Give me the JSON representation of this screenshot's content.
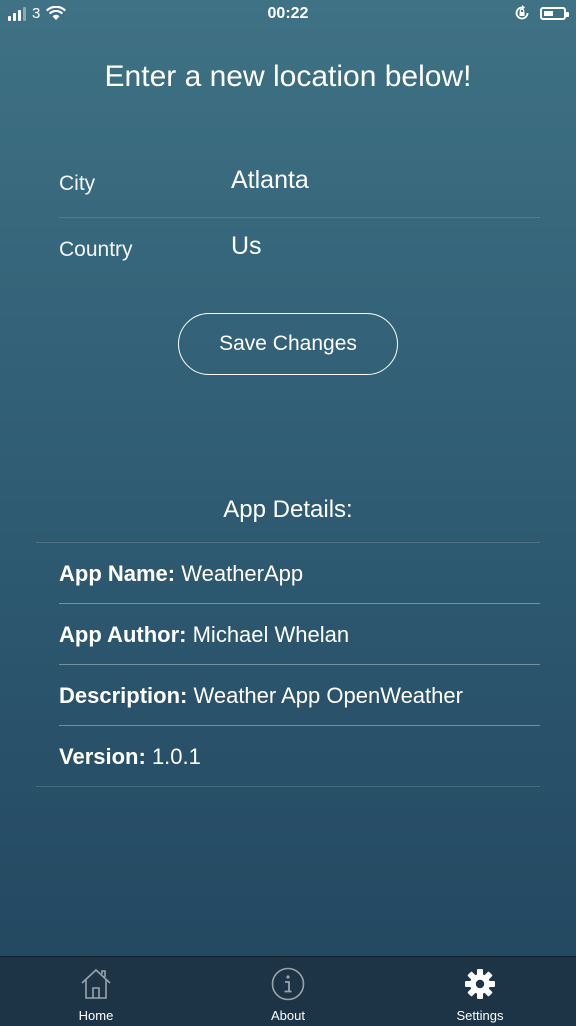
{
  "status_bar": {
    "carrier": "3",
    "time": "00:22"
  },
  "location_form": {
    "title": "Enter a new location below!",
    "city_label": "City",
    "city_value": "Atlanta",
    "country_label": "Country",
    "country_value": "Us",
    "save_label": "Save Changes"
  },
  "app_details": {
    "heading": "App Details:",
    "rows": [
      {
        "key": "App Name:",
        "value": "WeatherApp"
      },
      {
        "key": "App Author:",
        "value": "Michael Whelan"
      },
      {
        "key": "Description:",
        "value": "Weather App OpenWeather"
      },
      {
        "key": "Version:",
        "value": "1.0.1"
      }
    ]
  },
  "tab_bar": {
    "tabs": [
      {
        "label": "Home",
        "icon": "home-icon",
        "active": false
      },
      {
        "label": "About",
        "icon": "info-icon",
        "active": false
      },
      {
        "label": "Settings",
        "icon": "gear-icon",
        "active": true
      }
    ]
  }
}
